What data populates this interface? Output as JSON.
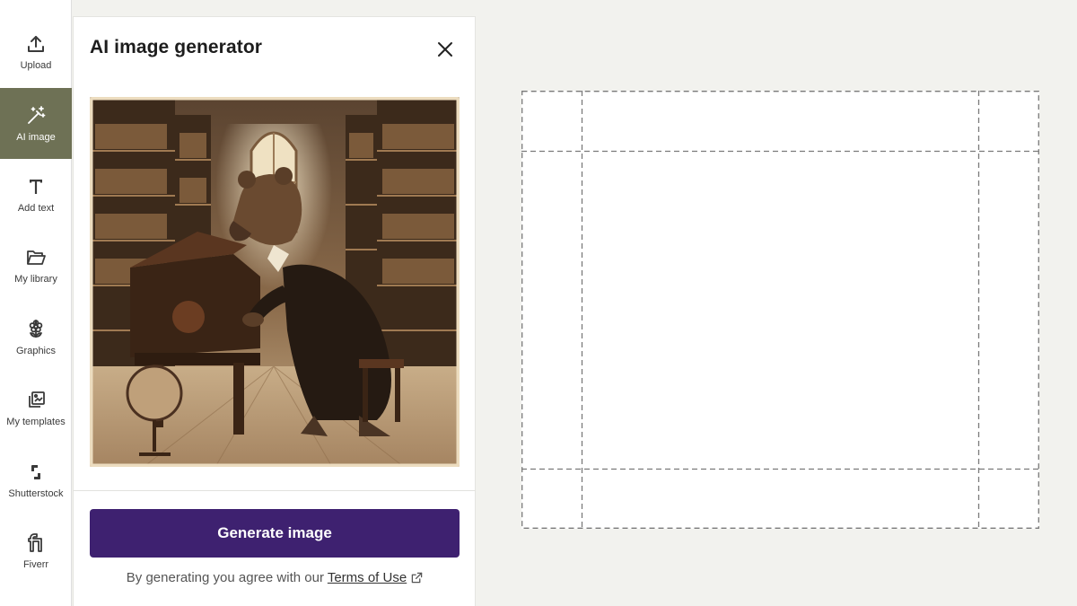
{
  "sidebar": {
    "items": [
      {
        "label": "Upload",
        "icon": "upload-icon"
      },
      {
        "label": "AI image",
        "icon": "magic-wand-icon",
        "active": true
      },
      {
        "label": "Add text",
        "icon": "text-icon"
      },
      {
        "label": "My library",
        "icon": "folder-icon"
      },
      {
        "label": "Graphics",
        "icon": "flower-icon"
      },
      {
        "label": "My templates",
        "icon": "templates-icon"
      },
      {
        "label": "Shutterstock",
        "icon": "shutterstock-icon"
      },
      {
        "label": "Fiverr",
        "icon": "fiverr-icon"
      }
    ],
    "active_color": "#6e7155"
  },
  "panel": {
    "title": "AI image generator",
    "close_icon": "close-icon",
    "preview_alt": "bear-playing-piano-library-illustration",
    "generate_label": "Generate image",
    "generate_color": "#3e2170",
    "terms_prefix": "By generating you agree with our",
    "terms_link": "Terms of Use",
    "terms_icon": "external-link-icon"
  },
  "canvas": {
    "guide_style": "dashed",
    "background": "#ffffff"
  }
}
